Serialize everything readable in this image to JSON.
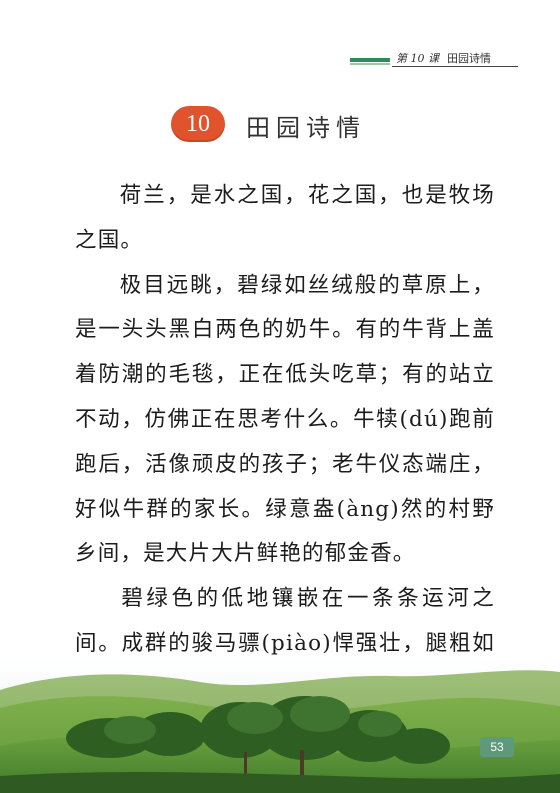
{
  "header": {
    "lesson": "第 10 课",
    "lesson_title": "田园诗情"
  },
  "title": {
    "number": "10",
    "text": "田园诗情"
  },
  "paragraphs": [
    "荷兰，是水之国，花之国，也是牧场之国。",
    "极目远眺，碧绿如丝绒般的草原上，是一头头黑白两色的奶牛。有的牛背上盖着防潮的毛毯，正在低头吃草；有的站立不动，仿佛正在思考什么。牛犊(dú)跑前跑后，活像顽皮的孩子；老牛仪态端庄，好似牛群的家长。绿意盎(àng)然的村野乡间，是大片大片鲜艳的郁金香。",
    "碧绿色的低地镶嵌在一条条运河之间。成群的骏马骠(piào)悍强壮，腿粗如桩，鬃(zōng)毛随风飞扬。除了深深的野草遮掩着的运河，没有什么能够阻挡它们"
  ],
  "page_number": "53",
  "colors": {
    "badge": "#e0532c",
    "header_bar": "#2e8b5a",
    "page_number_bg": "#5e9a7a"
  }
}
